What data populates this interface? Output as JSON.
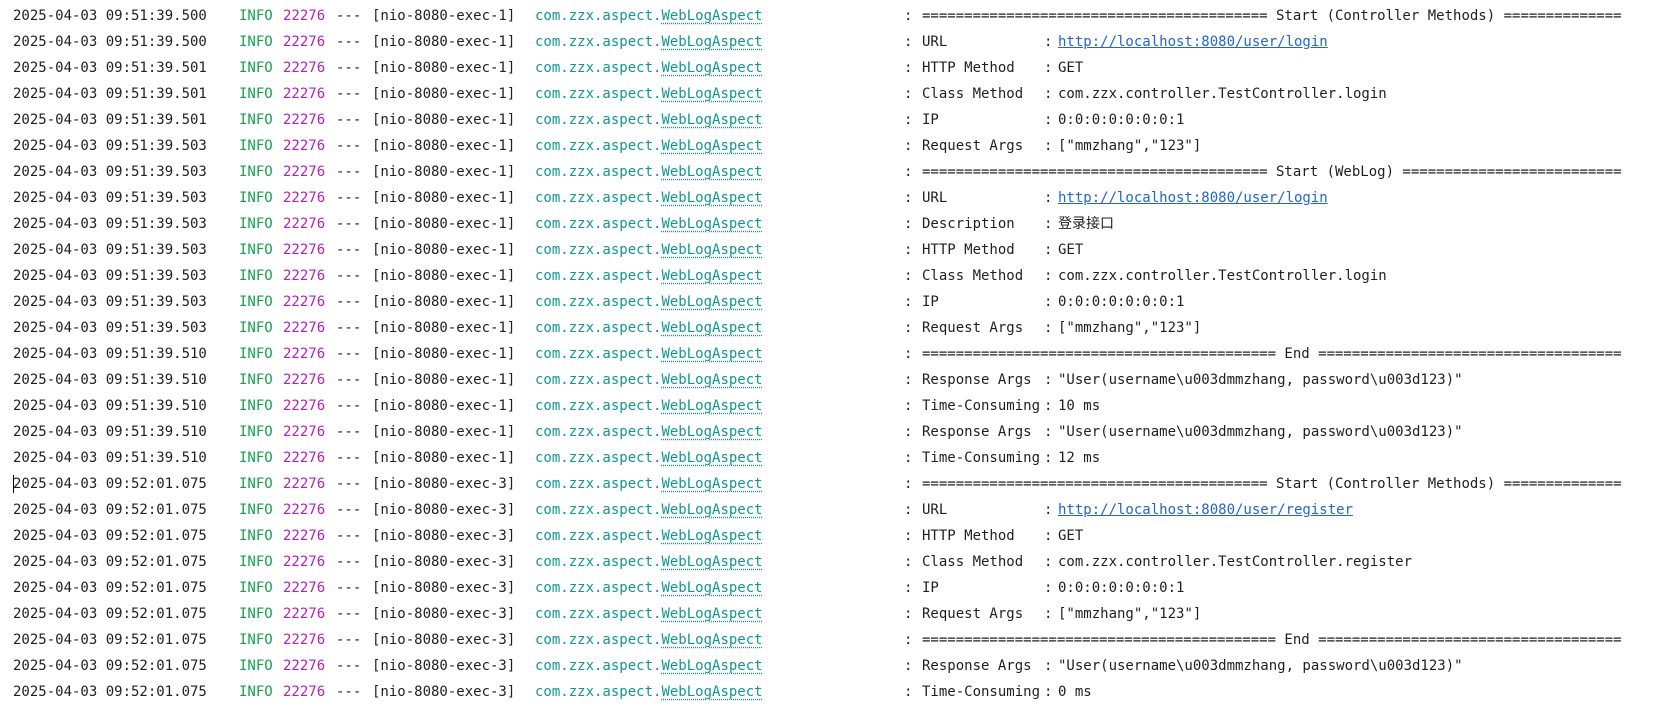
{
  "console": {
    "common": {
      "level": "INFO",
      "pid": "22276",
      "separator": "---",
      "package": "com.zzx.aspect.",
      "class_name": "WebLogAspect"
    },
    "lines": [
      {
        "ts": "2025-04-03 09:51:39.500",
        "thread": "[nio-8080-exec-1]",
        "kind": "banner",
        "text": "========================================= Start (Controller Methods) =============="
      },
      {
        "ts": "2025-04-03 09:51:39.500",
        "thread": "[nio-8080-exec-1]",
        "kind": "kv",
        "key": "URL",
        "value": "http://localhost:8080/user/login",
        "link": true
      },
      {
        "ts": "2025-04-03 09:51:39.501",
        "thread": "[nio-8080-exec-1]",
        "kind": "kv",
        "key": "HTTP Method",
        "value": "GET"
      },
      {
        "ts": "2025-04-03 09:51:39.501",
        "thread": "[nio-8080-exec-1]",
        "kind": "kv",
        "key": "Class Method",
        "value": "com.zzx.controller.TestController.login"
      },
      {
        "ts": "2025-04-03 09:51:39.501",
        "thread": "[nio-8080-exec-1]",
        "kind": "kv",
        "key": "IP",
        "value": "0:0:0:0:0:0:0:1"
      },
      {
        "ts": "2025-04-03 09:51:39.503",
        "thread": "[nio-8080-exec-1]",
        "kind": "kv",
        "key": "Request Args",
        "value": "[\"mmzhang\",\"123\"]"
      },
      {
        "ts": "2025-04-03 09:51:39.503",
        "thread": "[nio-8080-exec-1]",
        "kind": "banner",
        "text": "========================================= Start (WebLog) =========================="
      },
      {
        "ts": "2025-04-03 09:51:39.503",
        "thread": "[nio-8080-exec-1]",
        "kind": "kv",
        "key": "URL",
        "value": "http://localhost:8080/user/login",
        "link": true
      },
      {
        "ts": "2025-04-03 09:51:39.503",
        "thread": "[nio-8080-exec-1]",
        "kind": "kv",
        "key": "Description",
        "value": "登录接口"
      },
      {
        "ts": "2025-04-03 09:51:39.503",
        "thread": "[nio-8080-exec-1]",
        "kind": "kv",
        "key": "HTTP Method",
        "value": "GET"
      },
      {
        "ts": "2025-04-03 09:51:39.503",
        "thread": "[nio-8080-exec-1]",
        "kind": "kv",
        "key": "Class Method",
        "value": "com.zzx.controller.TestController.login"
      },
      {
        "ts": "2025-04-03 09:51:39.503",
        "thread": "[nio-8080-exec-1]",
        "kind": "kv",
        "key": "IP",
        "value": "0:0:0:0:0:0:0:1"
      },
      {
        "ts": "2025-04-03 09:51:39.503",
        "thread": "[nio-8080-exec-1]",
        "kind": "kv",
        "key": "Request Args",
        "value": "[\"mmzhang\",\"123\"]"
      },
      {
        "ts": "2025-04-03 09:51:39.510",
        "thread": "[nio-8080-exec-1]",
        "kind": "banner",
        "text": "========================================== End ===================================="
      },
      {
        "ts": "2025-04-03 09:51:39.510",
        "thread": "[nio-8080-exec-1]",
        "kind": "kv",
        "key": "Response Args",
        "value": "\"User(username\\u003dmmzhang, password\\u003d123)\""
      },
      {
        "ts": "2025-04-03 09:51:39.510",
        "thread": "[nio-8080-exec-1]",
        "kind": "kv",
        "key": "Time-Consuming",
        "value": "10 ms"
      },
      {
        "ts": "2025-04-03 09:51:39.510",
        "thread": "[nio-8080-exec-1]",
        "kind": "kv",
        "key": "Response Args",
        "value": "\"User(username\\u003dmmzhang, password\\u003d123)\""
      },
      {
        "ts": "2025-04-03 09:51:39.510",
        "thread": "[nio-8080-exec-1]",
        "kind": "kv",
        "key": "Time-Consuming",
        "value": "12 ms"
      },
      {
        "ts": "2025-04-03 09:52:01.075",
        "thread": "[nio-8080-exec-3]",
        "kind": "banner",
        "text": "========================================= Start (Controller Methods) ==============",
        "caret": true
      },
      {
        "ts": "2025-04-03 09:52:01.075",
        "thread": "[nio-8080-exec-3]",
        "kind": "kv",
        "key": "URL",
        "value": "http://localhost:8080/user/register",
        "link": true
      },
      {
        "ts": "2025-04-03 09:52:01.075",
        "thread": "[nio-8080-exec-3]",
        "kind": "kv",
        "key": "HTTP Method",
        "value": "GET"
      },
      {
        "ts": "2025-04-03 09:52:01.075",
        "thread": "[nio-8080-exec-3]",
        "kind": "kv",
        "key": "Class Method",
        "value": "com.zzx.controller.TestController.register"
      },
      {
        "ts": "2025-04-03 09:52:01.075",
        "thread": "[nio-8080-exec-3]",
        "kind": "kv",
        "key": "IP",
        "value": "0:0:0:0:0:0:0:1"
      },
      {
        "ts": "2025-04-03 09:52:01.075",
        "thread": "[nio-8080-exec-3]",
        "kind": "kv",
        "key": "Request Args",
        "value": "[\"mmzhang\",\"123\"]"
      },
      {
        "ts": "2025-04-03 09:52:01.075",
        "thread": "[nio-8080-exec-3]",
        "kind": "banner",
        "text": "========================================== End ===================================="
      },
      {
        "ts": "2025-04-03 09:52:01.075",
        "thread": "[nio-8080-exec-3]",
        "kind": "kv",
        "key": "Response Args",
        "value": "\"User(username\\u003dmmzhang, password\\u003d123)\""
      },
      {
        "ts": "2025-04-03 09:52:01.075",
        "thread": "[nio-8080-exec-3]",
        "kind": "kv",
        "key": "Time-Consuming",
        "value": "0 ms"
      }
    ]
  }
}
